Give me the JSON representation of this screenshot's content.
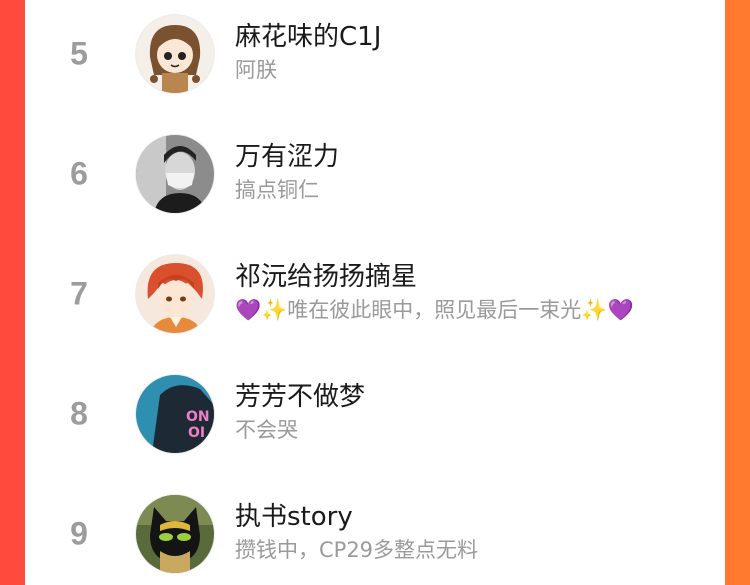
{
  "list": [
    {
      "rank": "5",
      "name": "麻花味的C1J",
      "subtitle": "阿朕",
      "avatar": "cartoon-girl-avatar"
    },
    {
      "rank": "6",
      "name": "万有涩力",
      "subtitle": "搞点铜仁",
      "avatar": "masked-man-avatar"
    },
    {
      "rank": "7",
      "name": "祁沅给扬扬摘星",
      "subtitle": "💜✨唯在彼此眼中，照见最后一束光✨💜",
      "avatar": "red-hair-anime-avatar"
    },
    {
      "rank": "8",
      "name": "芳芳不做梦",
      "subtitle": "不会哭",
      "avatar": "teal-jacket-avatar"
    },
    {
      "rank": "9",
      "name": "执书story",
      "subtitle": "攒钱中，CP29多整点无料",
      "avatar": "cat-noir-avatar"
    }
  ],
  "colors": {
    "bg_left": "#ff4a3d",
    "bg_right": "#ff7a2f",
    "rank": "#9c9c9c",
    "subtitle": "#9a9a9a"
  }
}
